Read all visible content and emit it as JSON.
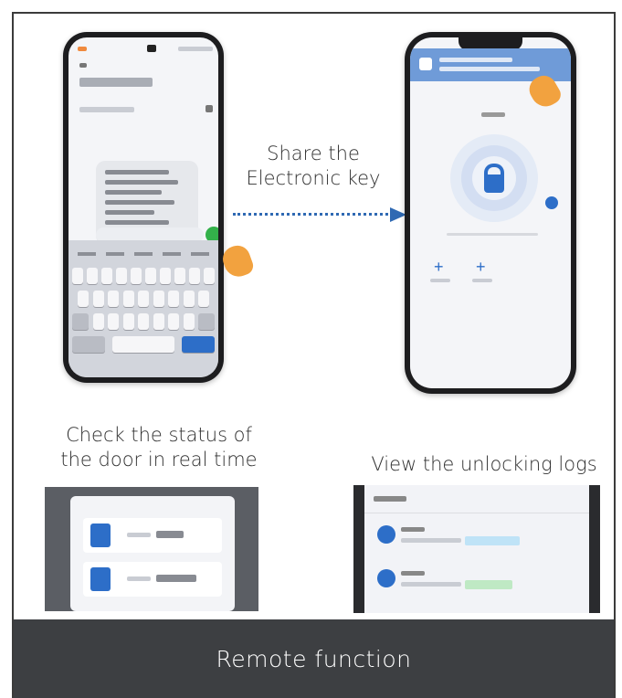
{
  "captions": {
    "share": "Share the\nElectronic key",
    "check": "Check the status of\nthe door in real time",
    "logs": "View the unlocking logs"
  },
  "banner": {
    "title": "Remote function"
  },
  "colors": {
    "accent": "#2d6ec8",
    "banner_bg": "#3d3f42",
    "arrow": "#2f69b3",
    "hand": "#f2a23f",
    "send": "#33b14a"
  },
  "icons": [
    "hand-pointer-icon",
    "lock-icon",
    "send-icon",
    "door-sensor-icon",
    "log-entry-icon",
    "share-arrow-icon"
  ]
}
